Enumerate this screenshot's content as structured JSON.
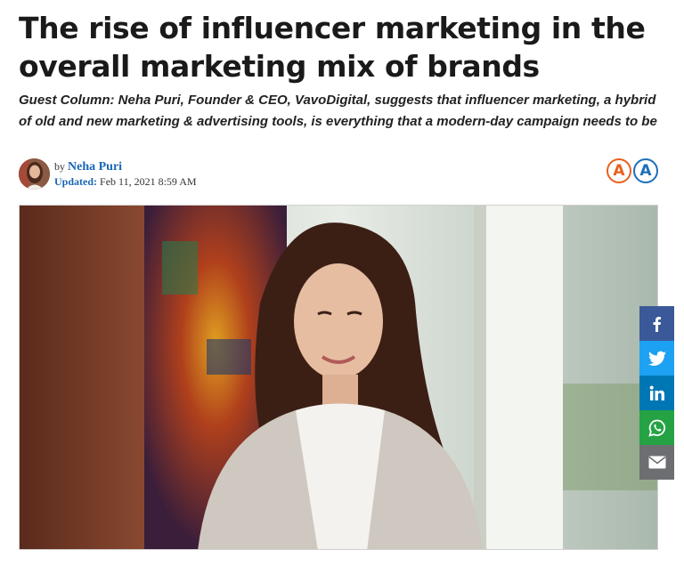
{
  "article": {
    "title": "The rise of influencer marketing in the overall marketing mix of brands",
    "summary": "Guest Column: Neha Puri, Founder & CEO, VavoDigital, suggests that influencer marketing, a hybrid of old and new marketing & advertising tools, is everything that a modern-day campaign needs to be"
  },
  "byline": {
    "by_prefix": "by",
    "author": "Neha Puri",
    "updated_label": "Updated:",
    "updated_value": "Feb 11, 2021 8:59 AM"
  },
  "font_controls": {
    "decrease": "A",
    "increase": "A"
  },
  "share": [
    {
      "name": "facebook",
      "icon": "facebook-icon",
      "color": "#3b5998"
    },
    {
      "name": "twitter",
      "icon": "twitter-icon",
      "color": "#1da1f2"
    },
    {
      "name": "linkedin",
      "icon": "linkedin-icon",
      "color": "#0077b5"
    },
    {
      "name": "whatsapp",
      "icon": "whatsapp-icon",
      "color": "#25a244"
    },
    {
      "name": "email",
      "icon": "email-icon",
      "color": "#6d6e71"
    }
  ],
  "colors": {
    "link_blue": "#1a66b3",
    "font_decrease": "#e8601c",
    "font_increase": "#1d6fb8"
  }
}
